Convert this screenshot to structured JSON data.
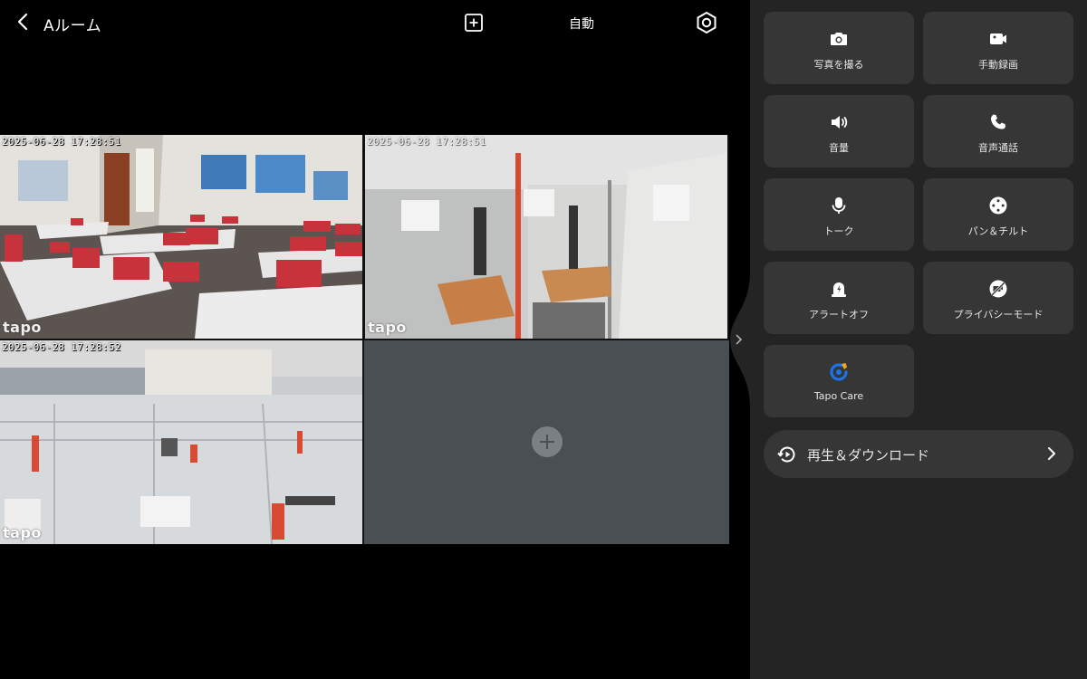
{
  "header": {
    "title": "Aルーム",
    "mode_label": "自動"
  },
  "cameras": [
    {
      "timestamp": "2025-06-28 17:28:51",
      "watermark": "tapo"
    },
    {
      "timestamp": "2025-06-28 17:28:51",
      "watermark": "tapo"
    },
    {
      "timestamp": "2025-06-28 17:28:52",
      "watermark": "tapo"
    }
  ],
  "controls": [
    {
      "label": "写真を撮る",
      "icon": "camera-icon"
    },
    {
      "label": "手動録画",
      "icon": "video-record-icon"
    },
    {
      "label": "音量",
      "icon": "volume-icon"
    },
    {
      "label": "音声通話",
      "icon": "phone-icon"
    },
    {
      "label": "トーク",
      "icon": "microphone-icon"
    },
    {
      "label": "パン＆チルト",
      "icon": "pan-tilt-icon"
    },
    {
      "label": "アラートオフ",
      "icon": "alarm-icon"
    },
    {
      "label": "プライバシーモード",
      "icon": "privacy-mode-icon"
    },
    {
      "label": "Tapo Care",
      "icon": "tapo-care-icon"
    }
  ],
  "playback": {
    "label": "再生＆ダウンロード"
  },
  "colors": {
    "panel_bg": "#242424",
    "tile_bg": "#363636",
    "empty_slot": "#4a4f53",
    "selected_outline": "#5b8fbf",
    "tapo_care_blue": "#1a73e8",
    "tapo_care_orange": "#f5a623"
  }
}
